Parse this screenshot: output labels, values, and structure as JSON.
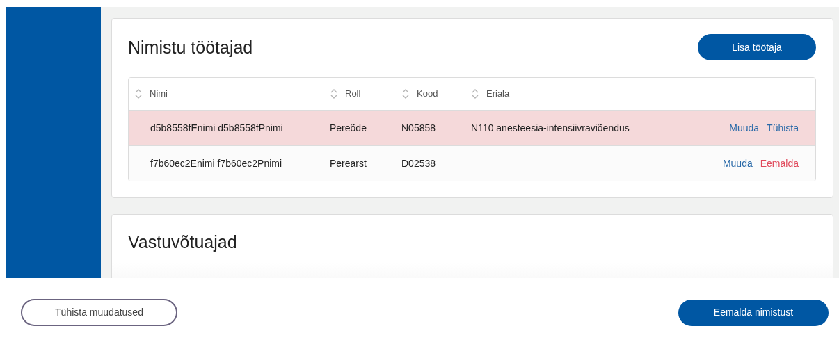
{
  "employees_card": {
    "title": "Nimistu töötajad",
    "add_button": "Lisa töötaja",
    "columns": [
      {
        "label": "Nimi",
        "sortable": true
      },
      {
        "label": "Roll",
        "sortable": true
      },
      {
        "label": "Kood",
        "sortable": true
      },
      {
        "label": "Eriala",
        "sortable": true
      }
    ],
    "rows": [
      {
        "cells": [
          "d5b8558fEnimi d5b8558fPnimi",
          "Pereõde",
          "N05858",
          "N110 anesteesia-intensiivraviõendus"
        ],
        "highlighted": true,
        "actions": [
          {
            "label": "Muuda",
            "kind": "link"
          },
          {
            "label": "Tühista",
            "kind": "link"
          }
        ]
      },
      {
        "cells": [
          "f7b60ec2Enimi f7b60ec2Pnimi",
          "Perearst",
          "D02538",
          ""
        ],
        "highlighted": false,
        "actions": [
          {
            "label": "Muuda",
            "kind": "link"
          },
          {
            "label": "Eemalda",
            "kind": "danger"
          }
        ]
      }
    ]
  },
  "reception_card": {
    "title": "Vastuvõtuajad"
  },
  "footer": {
    "cancel_button": "Tühista muudatused",
    "remove_button": "Eemalda nimistust"
  }
}
